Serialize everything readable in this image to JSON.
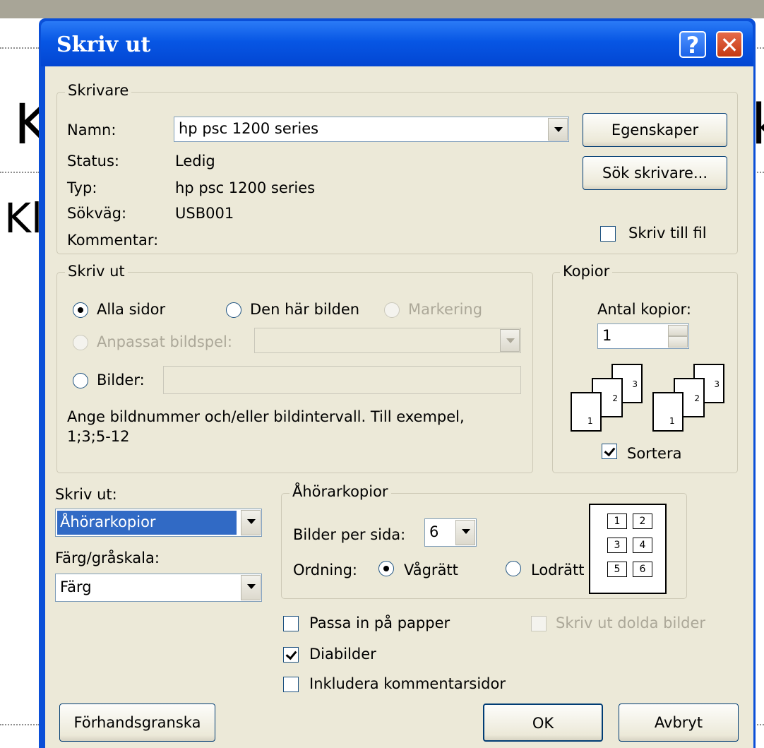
{
  "background": {
    "left_text": "K",
    "left_text2": "Kli",
    "right_text": "k"
  },
  "dialog": {
    "title": "Skriv ut",
    "help_glyph": "?",
    "close_glyph": "✕"
  },
  "printer": {
    "group_label": "Skrivare",
    "name_label": "Namn:",
    "name_value": "hp psc 1200 series",
    "status_label": "Status:",
    "status_value": "Ledig",
    "type_label": "Typ:",
    "type_value": "hp psc 1200 series",
    "path_label": "Sökväg:",
    "path_value": "USB001",
    "comment_label": "Kommentar:",
    "properties_button": "Egenskaper",
    "find_button": "Sök skrivare...",
    "print_to_file_label": "Skriv till fil"
  },
  "range": {
    "group_label": "Skriv ut",
    "all_label": "Alla sidor",
    "current_label": "Den här bilden",
    "selection_label": "Markering",
    "custom_show_label": "Anpassat bildspel:",
    "slides_label": "Bilder:",
    "hint": "Ange bildnummer och/eller bildintervall. Till exempel,",
    "hint2": "1;3;5-12"
  },
  "copies": {
    "group_label": "Kopior",
    "count_label": "Antal kopior:",
    "count_value": "1",
    "collate_label": "Sortera",
    "collated": true
  },
  "print_what": {
    "label": "Skriv ut:",
    "value": "Åhörarkopior",
    "color_label": "Färg/gråskala:",
    "color_value": "Färg"
  },
  "handouts": {
    "group_label": "Åhörarkopior",
    "per_page_label": "Bilder per sida:",
    "per_page_value": "6",
    "order_label": "Ordning:",
    "horizontal_label": "Vågrätt",
    "vertical_label": "Lodrätt",
    "preview_numbers": [
      "1",
      "2",
      "3",
      "4",
      "5",
      "6"
    ]
  },
  "options": {
    "fit_label": "Passa in på papper",
    "frame_label": "Diabilder",
    "comments_label": "Inkludera kommentarsidor",
    "hidden_label": "Skriv ut dolda bilder"
  },
  "footer": {
    "preview_button": "Förhandsgranska",
    "ok_button": "OK",
    "cancel_button": "Avbryt"
  },
  "colors": {
    "title_blue": "#0346d2",
    "dialog_face": "#ece9d8",
    "selection_blue": "#316ac5",
    "disabled_text": "#aca899"
  }
}
